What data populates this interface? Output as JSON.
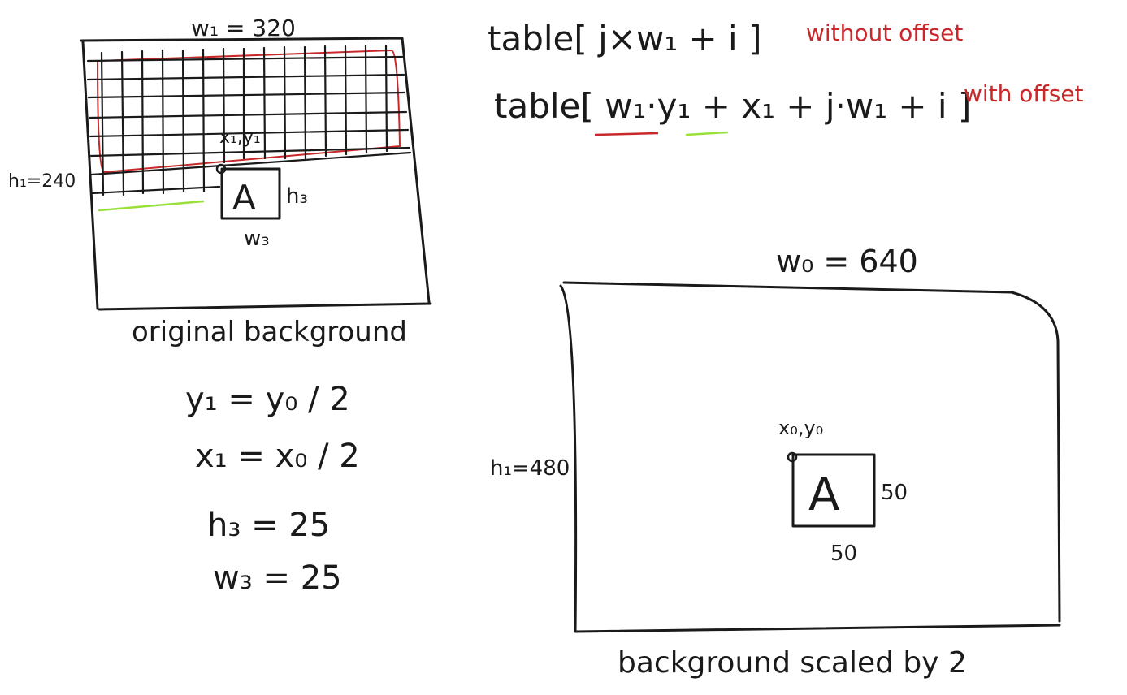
{
  "left_diagram": {
    "width_label": "w₁ = 320",
    "height_label": "h₁=240",
    "point_label": "x₁,y₁",
    "box_letter": "A",
    "box_h_label": "h₃",
    "box_w_label": "w₃",
    "caption": "original background"
  },
  "equations": {
    "y1": "y₁ = y₀ / 2",
    "x1": "x₁ = x₀ / 2",
    "h3": "h₃ = 25",
    "w3": "w₃ = 25"
  },
  "formulas": {
    "without_offset": "table[ j×w₁ + i ]",
    "without_offset_note": "without offset",
    "with_offset": "table[ w₁·y₁ + x₁ + j·w₁ + i ]",
    "with_offset_note": "with offset"
  },
  "right_diagram": {
    "width_label": "w₀ = 640",
    "height_label": "h₁=480",
    "point_label": "x₀,y₀",
    "box_letter": "A",
    "box_h_label": "50",
    "box_w_label": "50",
    "caption": "background scaled by 2"
  },
  "colors": {
    "ink": "#1a1a1a",
    "red": "#c8282a",
    "green": "#9ae03a"
  }
}
